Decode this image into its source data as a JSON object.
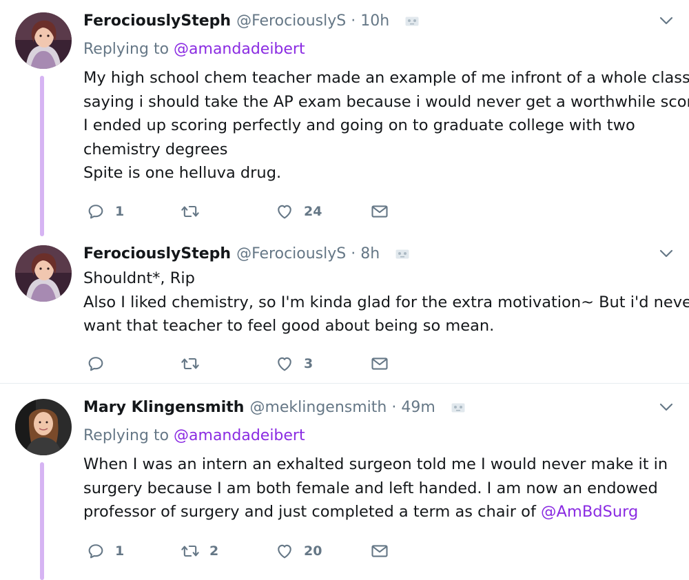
{
  "tweets": [
    {
      "name": "FerociouslySteph",
      "handle": "@FerociouslyS",
      "separator": "·",
      "time": "10h",
      "replying_prefix": "Replying to ",
      "replying_to": "@amandadeibert",
      "lines": [
        "My high school chem teacher made an example of me infront of a whole class,",
        "saying i should take the AP exam because i would never get a worthwhile score.",
        "I ended up scoring perfectly and going on to graduate college with two",
        "chemistry degrees",
        "Spite is one helluva drug."
      ],
      "replies": "1",
      "retweets": "",
      "likes": "24"
    },
    {
      "name": "FerociouslySteph",
      "handle": "@FerociouslyS",
      "separator": "·",
      "time": "8h",
      "lines": [
        "Shouldnt*, Rip",
        "Also I liked chemistry, so I'm kinda glad for the extra motivation~ But i'd never",
        "want that teacher to feel good about being so mean."
      ],
      "replies": "",
      "retweets": "",
      "likes": "3"
    },
    {
      "name": "Mary Klingensmith",
      "handle": "@meklingensmith",
      "separator": "·",
      "time": "49m",
      "replying_prefix": "Replying to ",
      "replying_to": "@amandadeibert",
      "lines": [
        "When I was an intern an exhalted surgeon told me I would never make it in",
        "surgery because I am both female and left handed. I am now an endowed"
      ],
      "last_line_text": "professor of surgery and just completed a term as chair of ",
      "last_line_mention": "@AmBdSurg",
      "replies": "1",
      "retweets": "2",
      "likes": "20"
    }
  ],
  "icons": {
    "reply": "reply-icon",
    "retweet": "retweet-icon",
    "like": "heart-icon",
    "message": "envelope-icon",
    "caret": "chevron-down-icon",
    "mute": "muted-icon"
  },
  "colors": {
    "mention": "#8a2be2",
    "thread_line": "#d6b4f3",
    "muted_text": "#657786"
  }
}
